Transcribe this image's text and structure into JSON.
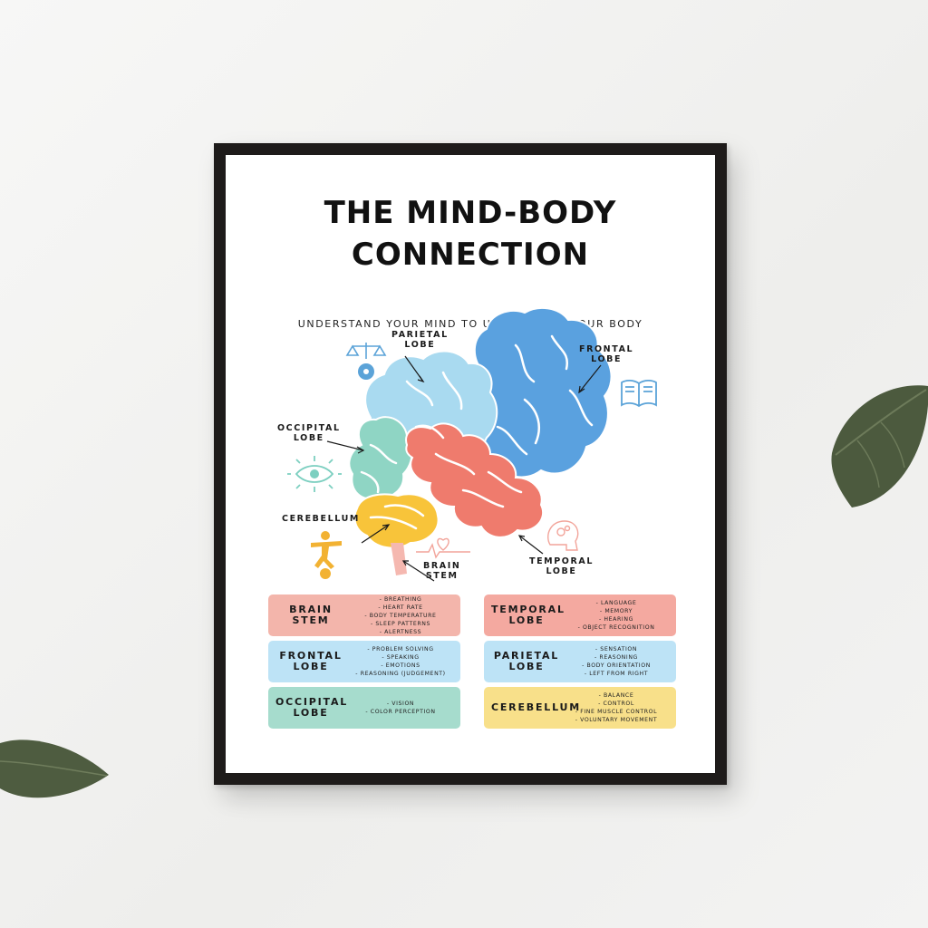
{
  "poster": {
    "title_line1": "THE MIND-BODY",
    "title_line2": "CONNECTION",
    "subtitle": "UNDERSTAND YOUR MIND TO UNDERSTAND YOUR BODY",
    "diagram_labels": {
      "parietal": "PARIETAL\nLOBE",
      "frontal": "FRONTAL\nLOBE",
      "occipital": "OCCIPITAL\nLOBE",
      "cerebellum": "CEREBELLUM",
      "brain_stem": "BRAIN\nSTEM",
      "temporal": "TEMPORAL\nLOBE"
    },
    "icons": [
      "scales-icon",
      "head-gear-icon",
      "open-book-icon",
      "eye-icon",
      "balancing-figure-icon",
      "heartbeat-icon",
      "head-thought-icon"
    ],
    "boxes": [
      {
        "name": "BRAIN\nSTEM",
        "color": "#f3b5ab",
        "items": [
          "- BREATHING",
          "- HEART RATE",
          "- BODY TEMPERATURE",
          "- SLEEP PATTERNS",
          "- ALERTNESS"
        ]
      },
      {
        "name": "TEMPORAL\nLOBE",
        "color": "#f4a9a0",
        "items": [
          "- LANGUAGE",
          "- MEMORY",
          "- HEARING",
          "- OBJECT RECOGNITION"
        ]
      },
      {
        "name": "FRONTAL\nLOBE",
        "color": "#bde3f6",
        "items": [
          "- PROBLEM SOLVING",
          "- SPEAKING",
          "- EMOTIONS",
          "- REASONING (JUDGEMENT)"
        ]
      },
      {
        "name": "PARIETAL\nLOBE",
        "color": "#bde3f6",
        "items": [
          "- SENSATION",
          "- REASONING",
          "- BODY ORIENTATION",
          "- LEFT FROM RIGHT"
        ]
      },
      {
        "name": "OCCIPITAL\nLOBE",
        "color": "#a6dccd",
        "items": [
          "- VISION",
          "- COLOR PERCEPTION"
        ]
      },
      {
        "name": "CEREBELLUM",
        "color": "#f8e08a",
        "items": [
          "- BALANCE",
          "- CONTROL",
          "- FINE MUSCLE CONTROL",
          "- VOLUNTARY MOVEMENT"
        ]
      }
    ]
  }
}
